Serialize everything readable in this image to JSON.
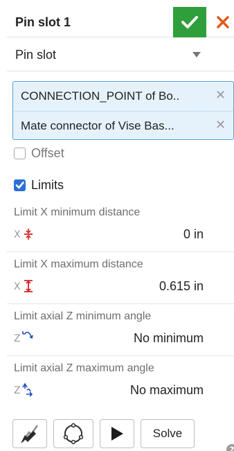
{
  "header": {
    "title": "Pin slot 1"
  },
  "mate_type": {
    "selected": "Pin slot"
  },
  "selections": [
    {
      "label": "CONNECTION_POINT of Bo.."
    },
    {
      "label": "Mate connector of Vise Bas..."
    }
  ],
  "options": {
    "offset_label": "Offset",
    "offset_checked": false,
    "limits_label": "Limits",
    "limits_checked": true
  },
  "limits": [
    {
      "label": "Limit X minimum distance",
      "value": "0 in",
      "icon": "x-min-distance-icon"
    },
    {
      "label": "Limit X maximum distance",
      "value": "0.615 in",
      "icon": "x-max-distance-icon"
    },
    {
      "label": "Limit axial Z minimum angle",
      "value": "No minimum",
      "icon": "z-min-angle-icon"
    },
    {
      "label": "Limit axial Z maximum angle",
      "value": "No maximum",
      "icon": "z-max-angle-icon"
    }
  ],
  "toolbar": {
    "solve_label": "Solve"
  },
  "colors": {
    "accept": "#2e9f3a",
    "cancel": "#e05a1c",
    "selection_bg": "#e5f2fb",
    "selection_border": "#5aa1d6",
    "checkbox_checked": "#2a6fd6",
    "limit_icon_red": "#d42222"
  }
}
